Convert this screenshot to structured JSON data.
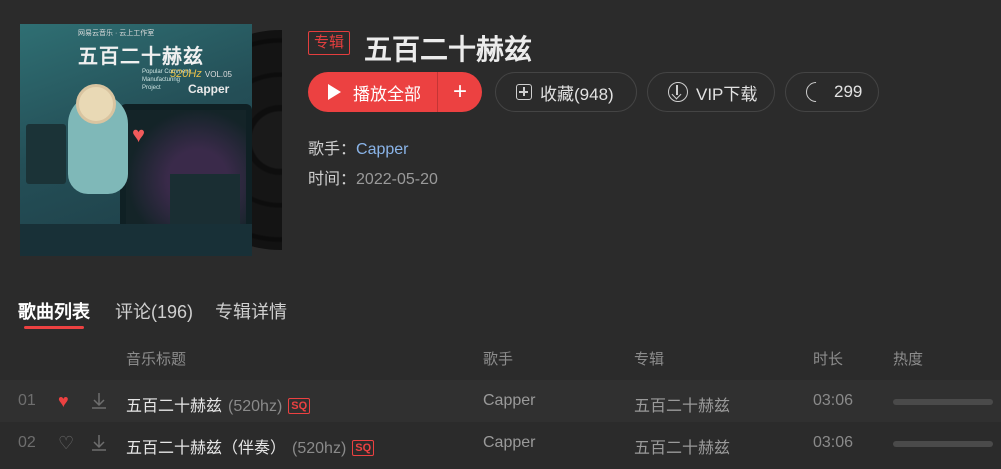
{
  "album": {
    "tag": "专辑",
    "title": "五百二十赫兹",
    "cover": {
      "top_text": "网易云音乐 · 云上工作室",
      "title": "五百二十赫兹",
      "subtitle": "520Hz",
      "small_text": "Popular Comment Manufacturing Project",
      "vol": "VOL.05",
      "artist": "Capper"
    }
  },
  "actions": {
    "play_all": "播放全部",
    "add": "+",
    "favorite": "收藏(948)",
    "vip_download": "VIP下载",
    "share": "299"
  },
  "meta": {
    "artist_label": "歌手：",
    "artist": "Capper",
    "time_label": "时间：",
    "time": "2022-05-20"
  },
  "tabs": [
    {
      "label": "歌曲列表",
      "active": true
    },
    {
      "label": "评论(196)",
      "active": false
    },
    {
      "label": "专辑详情",
      "active": false
    }
  ],
  "table": {
    "headers": {
      "title": "音乐标题",
      "artist": "歌手",
      "album": "专辑",
      "duration": "时长",
      "heat": "热度"
    },
    "rows": [
      {
        "index": "01",
        "liked": true,
        "title": "五百二十赫兹",
        "extra": "(520hz)",
        "quality": "SQ",
        "artist": "Capper",
        "album": "五百二十赫兹",
        "duration": "03:06",
        "heat": 1.0
      },
      {
        "index": "02",
        "liked": false,
        "title": "五百二十赫兹（伴奏）",
        "extra": "(520hz)",
        "quality": "SQ",
        "artist": "Capper",
        "album": "五百二十赫兹",
        "duration": "03:06",
        "heat": 1.0
      }
    ]
  },
  "colors": {
    "accent": "#ec4141",
    "background": "#2b2b2b",
    "link": "#8ab4e8"
  }
}
